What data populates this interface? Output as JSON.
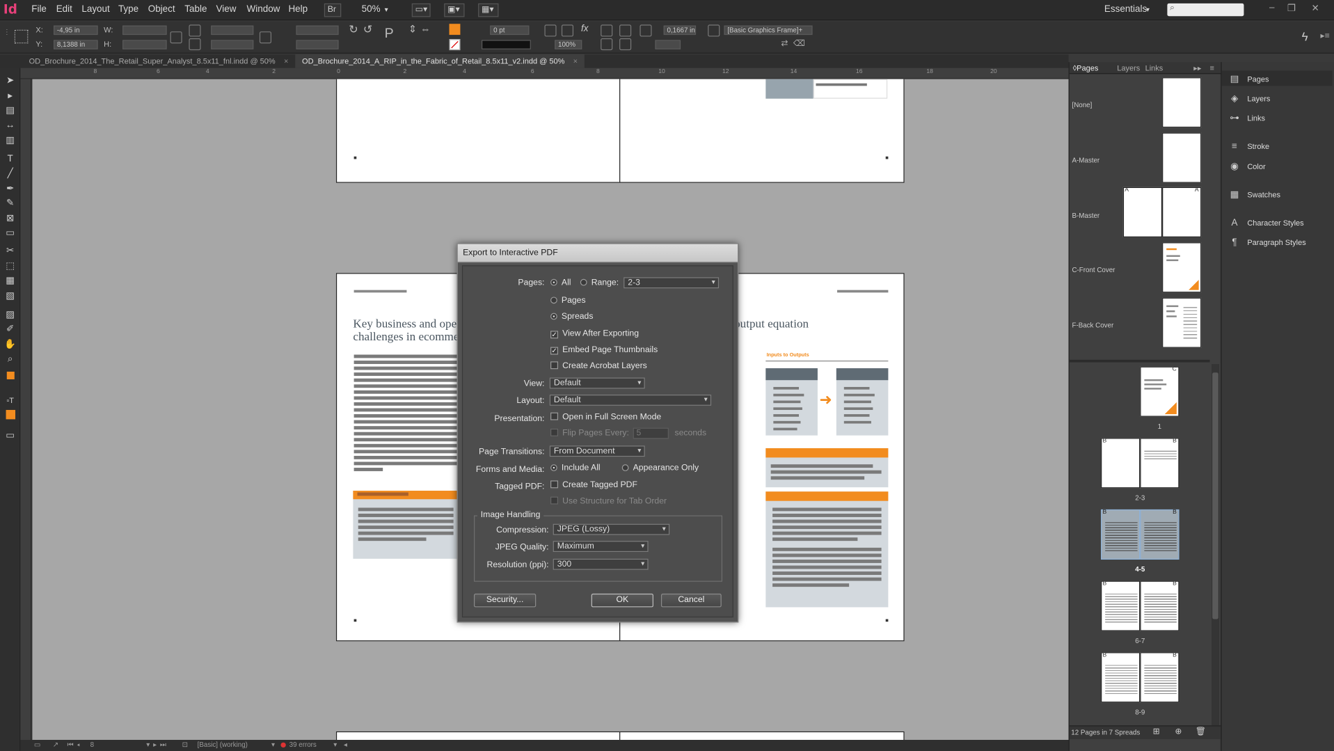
{
  "menubar": {
    "logo": "Id",
    "items": [
      "File",
      "Edit",
      "Layout",
      "Type",
      "Object",
      "Table",
      "View",
      "Window",
      "Help"
    ],
    "bridge": "Br",
    "zoom": "50%",
    "workspace": "Essentials"
  },
  "control": {
    "x_label": "X:",
    "x_value": "-4,95 in",
    "y_label": "Y:",
    "y_value": "8,1388 in",
    "w_label": "W:",
    "h_label": "H:",
    "stroke_weight": "0 pt",
    "opacity": "100%",
    "offset": "0,1667 in",
    "object_style": "[Basic Graphics Frame]+"
  },
  "tabs": [
    {
      "label": "OD_Brochure_2014_The_Retail_Super_Analyst_8.5x11_fnl.indd @ 50%",
      "close": "×"
    },
    {
      "label": "OD_Brochure_2014_A_RIP_in_the_Fabric_of_Retail_8.5x11_v2.indd @ 50%",
      "close": "×"
    }
  ],
  "ruler": [
    "8",
    "6",
    "4",
    "2",
    "0",
    "2",
    "4",
    "6",
    "8",
    "10",
    "12",
    "14",
    "16",
    "18",
    "20"
  ],
  "document": {
    "heading_left": "Key business and ope",
    "heading_left_2": "challenges in ecomme",
    "heading_right": "output equation",
    "inputs_label": "Inputs to Outputs"
  },
  "status": {
    "page": "8",
    "style": "[Basic] (working)",
    "errors": "39 errors"
  },
  "pages_panel": {
    "tabs": [
      "Pages",
      "Layers",
      "Links"
    ],
    "masters": [
      "[None]",
      "A-Master",
      "B-Master",
      "C-Front Cover",
      "F-Back Cover"
    ],
    "spreads": [
      {
        "label": "1",
        "prefix": "C"
      },
      {
        "label": "2-3",
        "prefix": "B"
      },
      {
        "label": "4-5",
        "prefix": "B"
      },
      {
        "label": "6-7",
        "prefix": "B"
      },
      {
        "label": "8-9",
        "prefix": "B"
      }
    ],
    "footer": "12 Pages in 7 Spreads"
  },
  "side_panels": [
    "Pages",
    "Layers",
    "Links",
    "Stroke",
    "Color",
    "Swatches",
    "Character Styles",
    "Paragraph Styles"
  ],
  "dialog": {
    "title": "Export to Interactive PDF",
    "pages_label": "Pages:",
    "all_label": "All",
    "range_label": "Range:",
    "range_value": "2-3",
    "pages_opt": "Pages",
    "spreads_opt": "Spreads",
    "view_after": "View After Exporting",
    "embed_thumbs": "Embed Page Thumbnails",
    "acrobat_layers": "Create Acrobat Layers",
    "view_label": "View:",
    "view_value": "Default",
    "layout_label": "Layout:",
    "layout_value": "Default",
    "presentation_label": "Presentation:",
    "full_screen": "Open in Full Screen Mode",
    "flip_pages": "Flip Pages Every:",
    "flip_value": "5",
    "seconds": "seconds",
    "transitions_label": "Page Transitions:",
    "transitions_value": "From Document",
    "forms_label": "Forms and Media:",
    "include_all": "Include All",
    "appearance_only": "Appearance Only",
    "tagged_label": "Tagged PDF:",
    "create_tagged": "Create Tagged PDF",
    "tab_order": "Use Structure for Tab Order",
    "image_handling": "Image Handling",
    "compression_label": "Compression:",
    "compression_value": "JPEG (Lossy)",
    "quality_label": "JPEG Quality:",
    "quality_value": "Maximum",
    "resolution_label": "Resolution (ppi):",
    "resolution_value": "300",
    "security_btn": "Security...",
    "ok_btn": "OK",
    "cancel_btn": "Cancel"
  },
  "colors": {
    "accent": "#f28c1f",
    "brand": "#e8407a"
  }
}
